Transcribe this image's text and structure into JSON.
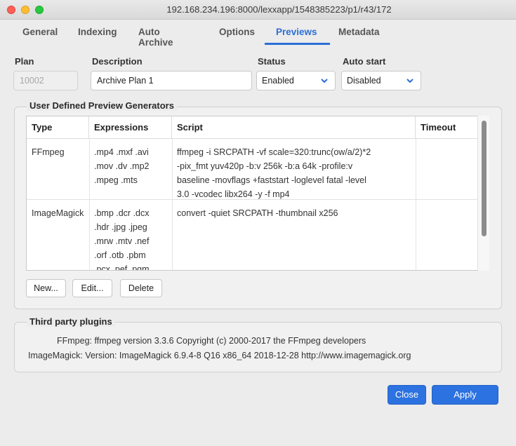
{
  "window": {
    "title": "192.168.234.196:8000/lexxapp/1548385223/p1/r43/172"
  },
  "tabs": [
    {
      "label": "General"
    },
    {
      "label": "Indexing"
    },
    {
      "label": "Auto Archive"
    },
    {
      "label": "Options"
    },
    {
      "label": "Previews",
      "active": true
    },
    {
      "label": "Metadata"
    }
  ],
  "plan": {
    "plan_label": "Plan",
    "plan_value": "10002",
    "description_label": "Description",
    "description_value": "Archive Plan  1",
    "status_label": "Status",
    "status_value": "Enabled",
    "autostart_label": "Auto start",
    "autostart_value": "Disabled"
  },
  "generators": {
    "title": "User Defined Preview Generators",
    "columns": [
      "Type",
      "Expressions",
      "Script",
      "Timeout"
    ],
    "rows": [
      {
        "type": "FFmpeg",
        "expressions": ".mp4 .mxf .avi\n.mov .dv .mp2\n.mpeg .mts",
        "script": "ffmpeg -i SRCPATH -vf scale=320:trunc(ow/a/2)*2\n-pix_fmt yuv420p -b:v 256k -b:a 64k -profile:v\nbaseline -movflags +faststart -loglevel fatal -level\n3.0 -vcodec libx264 -y -f mp4",
        "timeout": ""
      },
      {
        "type": "ImageMagick",
        "expressions": ".bmp .dcr .dcx\n.hdr .jpg .jpeg\n.mrw .mtv .nef\n.orf .otb .pbm\n.pcx .pef .pgm",
        "script": "convert -quiet SRCPATH -thumbnail x256",
        "timeout": ""
      }
    ],
    "buttons": {
      "new": "New...",
      "edit": "Edit...",
      "delete": "Delete"
    }
  },
  "plugins": {
    "title": "Third party plugins",
    "items": [
      {
        "name": "FFmpeg:",
        "value": "ffmpeg version 3.3.6 Copyright (c) 2000-2017 the FFmpeg developers"
      },
      {
        "name": "ImageMagick:",
        "value": "Version: ImageMagick 6.9.4-8 Q16 x86_64 2018-12-28 http://www.imagemagick.org"
      }
    ]
  },
  "footer": {
    "close": "Close",
    "apply": "Apply"
  },
  "colors": {
    "accent": "#2b6fd6",
    "primary_button": "#2c72e0"
  }
}
